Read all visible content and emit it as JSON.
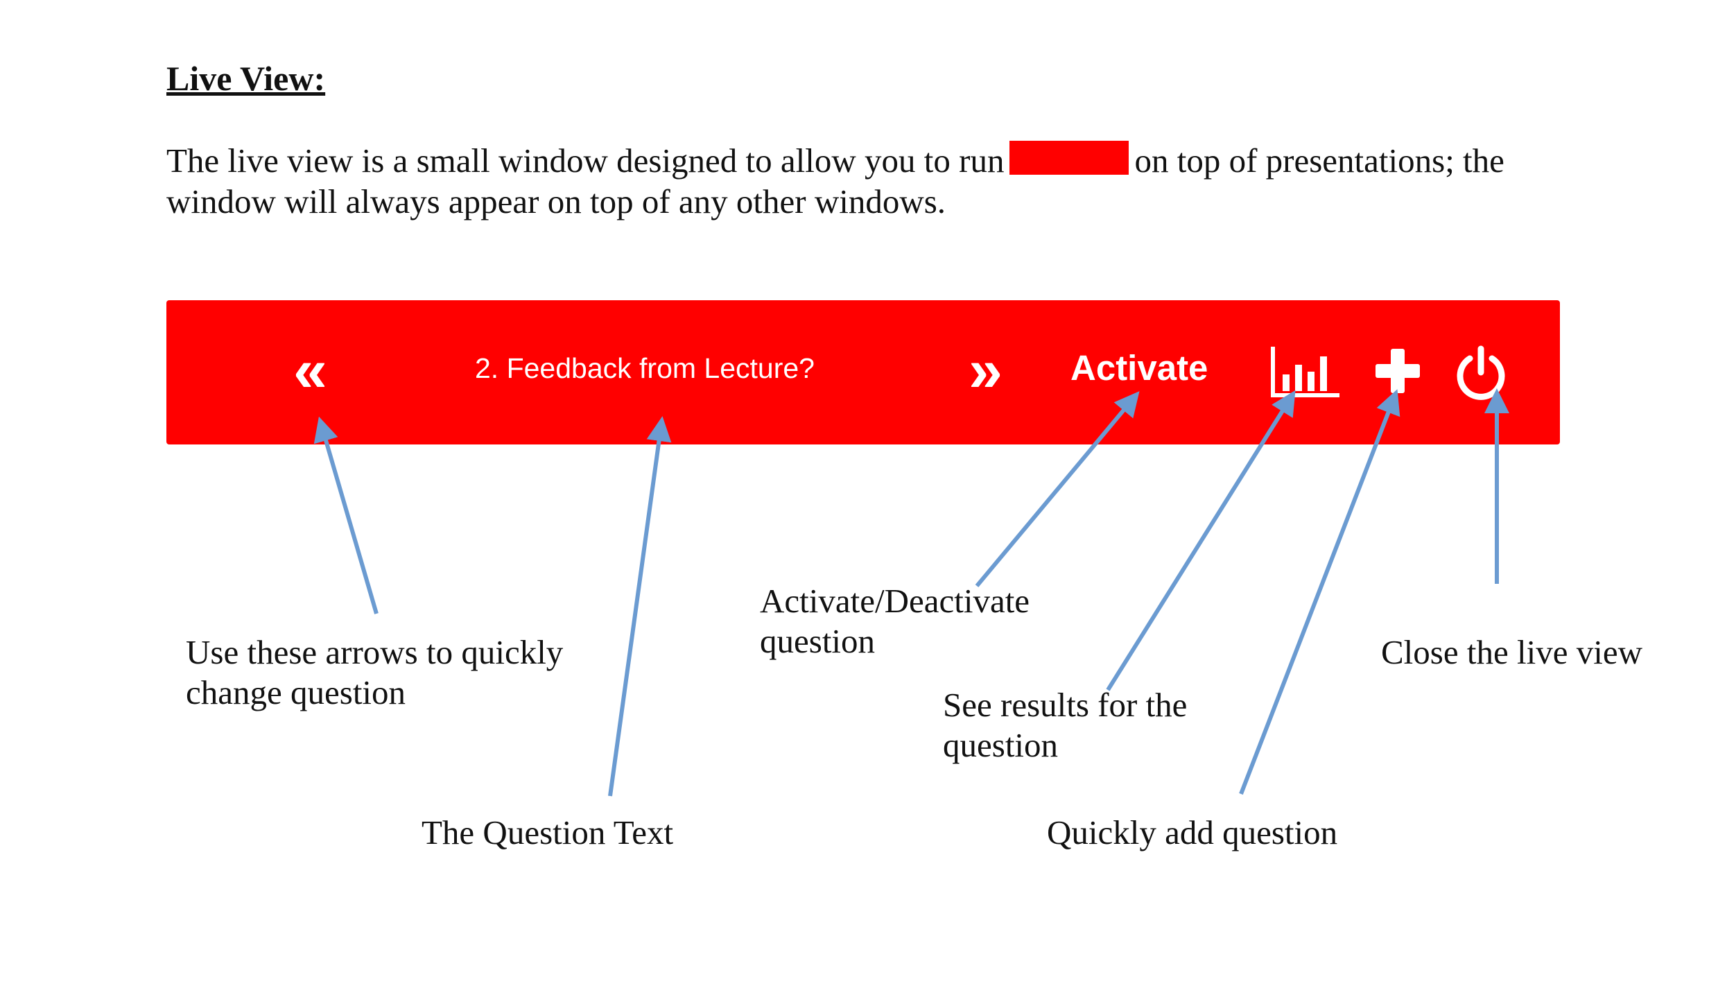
{
  "doc": {
    "heading": "Live View:",
    "intro_before": "The live view is a small window designed to allow you to run",
    "intro_after": "on top of presentations; the window will always appear on top of any other windows."
  },
  "colors": {
    "bar": "#ff0000",
    "redaction": "#ff0000",
    "arrow": "#6b9bd1",
    "bar_text": "#ffffff"
  },
  "live_view": {
    "prev_icon": "double-chevron-left-icon",
    "prev_glyph": "«",
    "question_text": "2. Feedback from Lecture?",
    "next_icon": "double-chevron-right-icon",
    "next_glyph": "»",
    "activate_label": "Activate",
    "results_icon": "bar-chart-icon",
    "add_icon": "plus-icon",
    "close_icon": "power-icon"
  },
  "callouts": {
    "arrows": [
      "Use these arrows to quickly",
      "change question"
    ],
    "question_text": "The Question Text",
    "activate": [
      "Activate/Deactivate",
      "question"
    ],
    "results": [
      "See results for the",
      "question"
    ],
    "add": "Quickly add question",
    "close": "Close the live view"
  }
}
